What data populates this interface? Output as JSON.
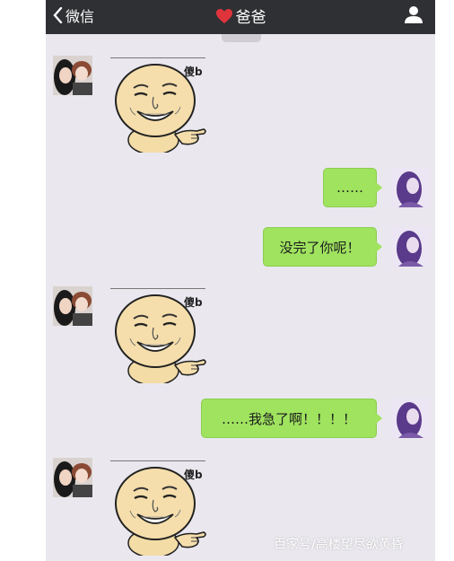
{
  "header": {
    "back_label": "微信",
    "title": "爸爸"
  },
  "messages": [
    {
      "side": "left",
      "type": "sticker",
      "sticker_text": "傻b"
    },
    {
      "side": "right",
      "type": "text",
      "text": "……"
    },
    {
      "side": "right",
      "type": "text",
      "text": "没完了你呢！"
    },
    {
      "side": "left",
      "type": "sticker",
      "sticker_text": "傻b"
    },
    {
      "side": "right",
      "type": "text",
      "text": "……我急了啊！！！！"
    },
    {
      "side": "left",
      "type": "sticker",
      "sticker_text": "傻b"
    }
  ],
  "watermark": "百家号/高楼望尽欲黄昏",
  "colors": {
    "header_bg": "#2f3033",
    "chat_bg": "#eae8ee",
    "bubble_green": "#9fe35f",
    "heart_red": "#e0343c"
  },
  "icons": {
    "back": "chevron-left-icon",
    "heart": "heart-icon",
    "profile": "user-icon"
  }
}
